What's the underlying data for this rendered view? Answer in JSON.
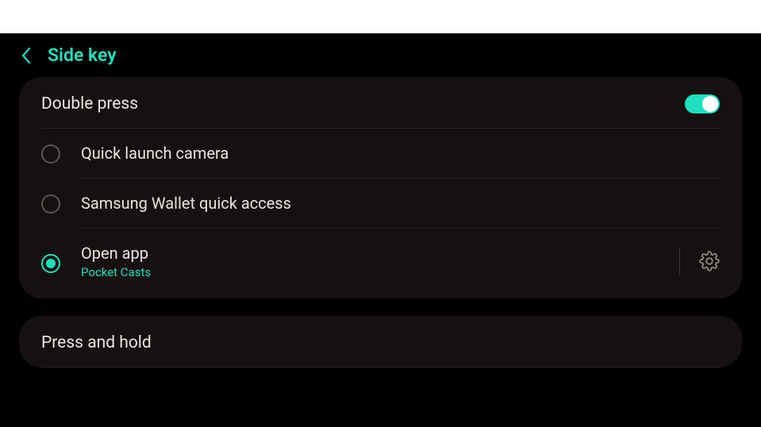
{
  "header": {
    "title": "Side key"
  },
  "sections": {
    "double_press": {
      "title": "Double press",
      "toggle_on": true,
      "options": {
        "camera": {
          "label": "Quick launch camera",
          "selected": false
        },
        "wallet": {
          "label": "Samsung Wallet quick access",
          "selected": false
        },
        "open_app": {
          "label": "Open app",
          "sub": "Pocket Casts",
          "selected": true
        }
      }
    },
    "press_hold": {
      "title": "Press and hold"
    }
  }
}
